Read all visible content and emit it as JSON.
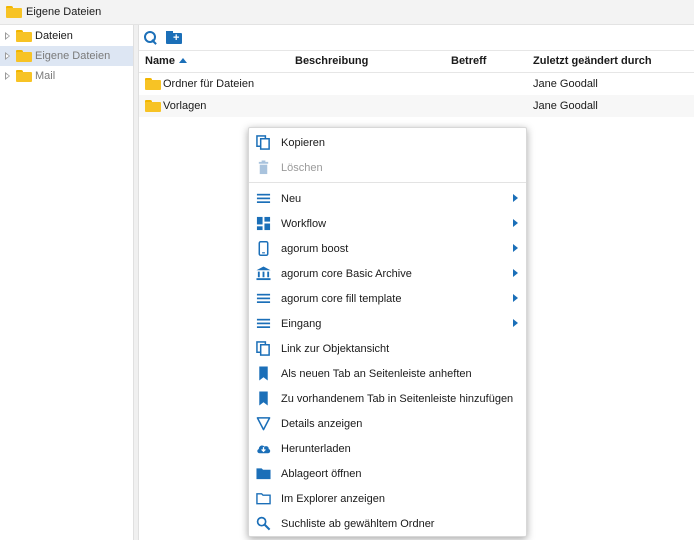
{
  "window": {
    "title": "Eigene Dateien"
  },
  "sidebar": {
    "items": [
      {
        "label": "Dateien",
        "selected": false,
        "muted": false
      },
      {
        "label": "Eigene Dateien",
        "selected": true,
        "muted": true
      },
      {
        "label": "Mail",
        "selected": false,
        "muted": true
      }
    ]
  },
  "toolbar": {
    "icons": [
      "search-icon",
      "new-folder-icon"
    ]
  },
  "table": {
    "columns": [
      "Name",
      "Beschreibung",
      "Betreff",
      "Zuletzt geändert durch"
    ],
    "sort": {
      "column": "Name",
      "direction": "ascending"
    },
    "rows": [
      {
        "name": "Ordner für Dateien",
        "beschreibung": "",
        "betreff": "",
        "modified_by": "Jane Goodall"
      },
      {
        "name": "Vorlagen",
        "beschreibung": "",
        "betreff": "",
        "modified_by": "Jane Goodall"
      }
    ]
  },
  "context_menu": {
    "items": [
      {
        "label": "Kopieren",
        "icon": "copy-icon",
        "disabled": false,
        "submenu": false
      },
      {
        "label": "Löschen",
        "icon": "trash-icon",
        "disabled": true,
        "submenu": false
      },
      {
        "label": "Neu",
        "icon": "lines-icon",
        "disabled": false,
        "submenu": true
      },
      {
        "label": "Workflow",
        "icon": "dashboard-icon",
        "disabled": false,
        "submenu": true
      },
      {
        "label": "agorum boost",
        "icon": "phone-icon",
        "disabled": false,
        "submenu": true
      },
      {
        "label": "agorum core Basic Archive",
        "icon": "bank-icon",
        "disabled": false,
        "submenu": true
      },
      {
        "label": "agorum core fill template",
        "icon": "lines-icon",
        "disabled": false,
        "submenu": true
      },
      {
        "label": "Eingang",
        "icon": "lines-icon",
        "disabled": false,
        "submenu": true
      },
      {
        "label": "Link zur Objektansicht",
        "icon": "copy-icon",
        "disabled": false,
        "submenu": false
      },
      {
        "label": "Als neuen Tab an Seitenleiste anheften",
        "icon": "bookmark-icon",
        "disabled": false,
        "submenu": false
      },
      {
        "label": "Zu vorhandenem Tab in Seitenleiste hinzufügen",
        "icon": "bookmark-icon",
        "disabled": false,
        "submenu": false
      },
      {
        "label": "Details anzeigen",
        "icon": "triangle-down-icon",
        "disabled": false,
        "submenu": false
      },
      {
        "label": "Herunterladen",
        "icon": "cloud-download-icon",
        "disabled": false,
        "submenu": false
      },
      {
        "label": "Ablageort öffnen",
        "icon": "folder-icon",
        "disabled": false,
        "submenu": false
      },
      {
        "label": "Im Explorer anzeigen",
        "icon": "folder-outline-icon",
        "disabled": false,
        "submenu": false
      },
      {
        "label": "Suchliste ab gewähltem Ordner",
        "icon": "search-icon",
        "disabled": false,
        "submenu": false
      }
    ]
  },
  "colors": {
    "accent": "#1b6fb8",
    "folder": "#f7c325",
    "selection": "#dde6f3",
    "disabled_icon": "#a9c3dd"
  }
}
